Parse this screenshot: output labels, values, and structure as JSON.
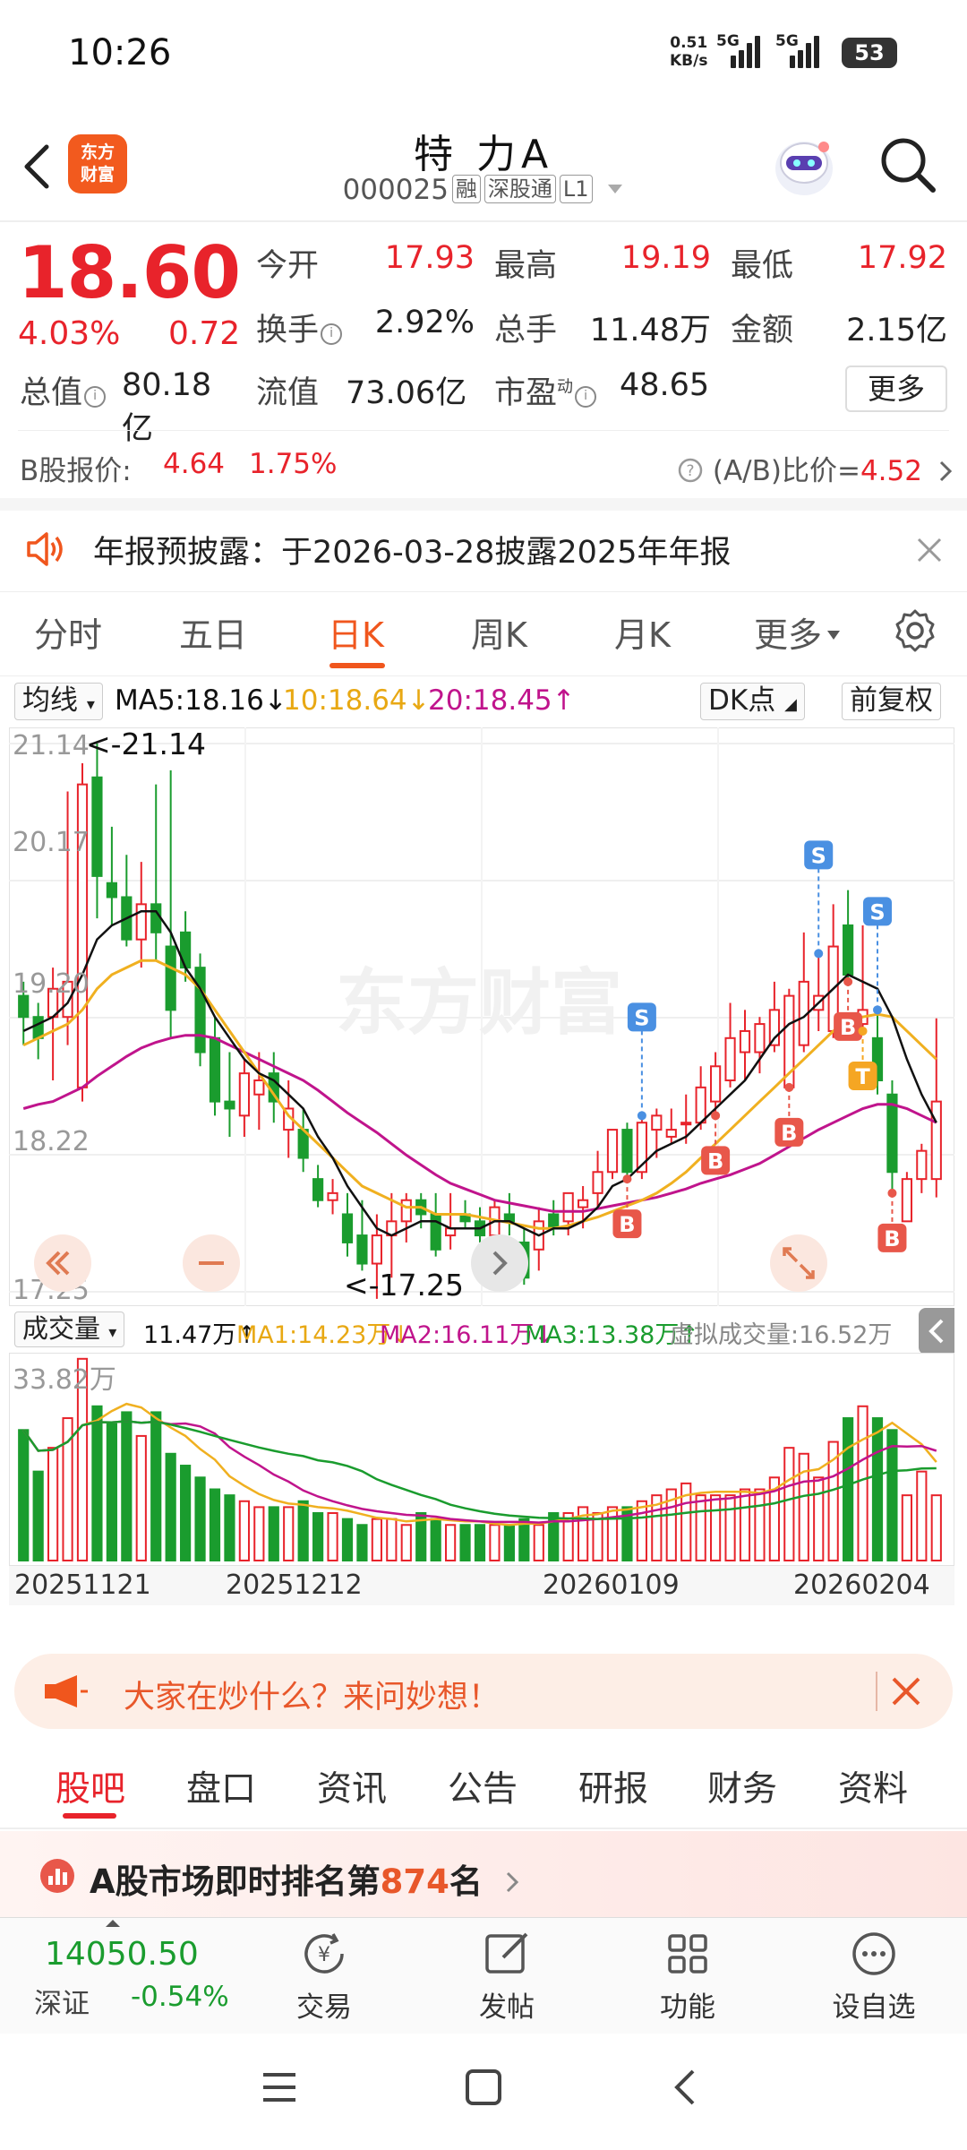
{
  "status_bar": {
    "time": "10:26",
    "net_speed_value": "0.51",
    "net_speed_unit": "KB/s",
    "sim1": "5G",
    "sim2": "5G",
    "battery": "53"
  },
  "header": {
    "brand_line1": "东方",
    "brand_line2": "财富",
    "stock_name": "特 力A",
    "stock_code": "000025",
    "tags": [
      "融",
      "深股通",
      "L1"
    ]
  },
  "quote": {
    "price": "18.60",
    "change_pct": "4.03%",
    "change": "0.72",
    "open_label": "今开",
    "open": "17.93",
    "high_label": "最高",
    "high": "19.19",
    "low_label": "最低",
    "low": "17.92",
    "turnover_label": "换手",
    "turnover": "2.92%",
    "volume_label": "总手",
    "volume": "11.48万",
    "amount_label": "金额",
    "amount": "2.15亿",
    "mcap_label": "总值",
    "mcap": "80.18亿",
    "float_label": "流值",
    "float_cap": "73.06亿",
    "pe_label": "市盈",
    "pe_sup": "动",
    "pe": "48.65",
    "more_label": "更多",
    "b_label": "B股报价:",
    "b_price": "4.64",
    "b_pct": "1.75%",
    "ab_label": "(A/B)比价=",
    "ab_value": "4.52"
  },
  "notice": {
    "text": "年报预披露：于2026-03-28披露2025年年报"
  },
  "period_tabs": [
    "分时",
    "五日",
    "日K",
    "周K",
    "月K",
    "更多"
  ],
  "ma_row": {
    "selector": "均线",
    "ma5": "MA5:18.16↓",
    "ma10": "10:18.64↓",
    "ma20": "20:18.45↑",
    "dk": "DK点",
    "adjust": "前复权"
  },
  "colors": {
    "up": "#e8232b",
    "down": "#1a9c2e",
    "ma5": "#111111",
    "ma10": "#f0b020",
    "ma20": "#c0148c",
    "accent": "#f0561d"
  },
  "kline_labels": {
    "y_ticks": [
      "21.14",
      "20.17",
      "19.20",
      "18.22",
      "17.25"
    ],
    "max_note": "<-21.14",
    "min_note": "<-17.25",
    "watermark": "东方财富"
  },
  "volume_head": {
    "selector": "成交量",
    "vol": "11.47万↑",
    "ma1": "MA1:14.23万↓",
    "ma2": "MA2:16.11万↓",
    "ma3": "MA3:13.38万↑",
    "virtual": "虚拟成交量:16.52万",
    "y_max": "33.82万"
  },
  "dates": [
    "20251121",
    "20251212",
    "20260109",
    "20260204"
  ],
  "chart_data": {
    "type": "candlestick",
    "ylim": [
      17.25,
      21.14
    ],
    "ohlc": [
      [
        19.35,
        19.45,
        19.0,
        19.2
      ],
      [
        19.2,
        19.3,
        18.9,
        19.05
      ],
      [
        19.2,
        19.55,
        18.75,
        19.4
      ],
      [
        19.2,
        20.8,
        19.0,
        19.45
      ],
      [
        18.7,
        21.0,
        18.6,
        20.85
      ],
      [
        20.9,
        21.14,
        19.9,
        20.2
      ],
      [
        20.15,
        20.55,
        19.85,
        20.05
      ],
      [
        20.05,
        20.35,
        19.7,
        19.75
      ],
      [
        19.75,
        20.3,
        19.55,
        20.0
      ],
      [
        20.0,
        20.85,
        19.6,
        19.8
      ],
      [
        19.7,
        20.95,
        19.05,
        19.25
      ],
      [
        19.8,
        19.95,
        19.45,
        19.55
      ],
      [
        19.55,
        19.65,
        18.85,
        18.95
      ],
      [
        19.05,
        19.2,
        18.5,
        18.6
      ],
      [
        18.6,
        18.95,
        18.35,
        18.55
      ],
      [
        18.5,
        18.9,
        18.35,
        18.8
      ],
      [
        18.65,
        18.95,
        18.4,
        18.75
      ],
      [
        18.8,
        18.95,
        18.45,
        18.6
      ],
      [
        18.4,
        18.75,
        18.2,
        18.55
      ],
      [
        18.4,
        18.55,
        18.1,
        18.2
      ],
      [
        18.05,
        18.15,
        17.85,
        17.9
      ],
      [
        17.9,
        18.05,
        17.8,
        17.95
      ],
      [
        17.8,
        17.95,
        17.5,
        17.6
      ],
      [
        17.65,
        17.9,
        17.4,
        17.45
      ],
      [
        17.45,
        17.8,
        17.2,
        17.65
      ],
      [
        17.65,
        17.95,
        17.35,
        17.75
      ],
      [
        17.75,
        17.95,
        17.6,
        17.9
      ],
      [
        17.9,
        17.95,
        17.7,
        17.8
      ],
      [
        17.8,
        17.95,
        17.5,
        17.55
      ],
      [
        17.65,
        17.95,
        17.55,
        17.7
      ],
      [
        17.8,
        17.9,
        17.7,
        17.75
      ],
      [
        17.75,
        17.85,
        17.6,
        17.65
      ],
      [
        17.65,
        17.9,
        17.55,
        17.85
      ],
      [
        17.8,
        17.95,
        17.65,
        17.75
      ],
      [
        17.6,
        17.7,
        17.3,
        17.35
      ],
      [
        17.55,
        17.85,
        17.4,
        17.75
      ],
      [
        17.8,
        17.9,
        17.65,
        17.7
      ],
      [
        17.75,
        17.95,
        17.65,
        17.95
      ],
      [
        17.85,
        18.0,
        17.7,
        17.9
      ],
      [
        17.95,
        18.25,
        17.85,
        18.1
      ],
      [
        18.1,
        18.4,
        18.05,
        18.4
      ],
      [
        18.4,
        18.45,
        18.05,
        18.1
      ],
      [
        18.1,
        18.5,
        18.05,
        18.45
      ],
      [
        18.4,
        18.55,
        18.2,
        18.5
      ],
      [
        18.35,
        18.55,
        18.3,
        18.4
      ],
      [
        18.45,
        18.65,
        18.3,
        18.45
      ],
      [
        18.45,
        18.85,
        18.4,
        18.7
      ],
      [
        18.6,
        18.95,
        18.5,
        18.85
      ],
      [
        18.75,
        19.3,
        18.7,
        19.05
      ],
      [
        18.95,
        19.25,
        18.75,
        19.1
      ],
      [
        18.95,
        19.2,
        18.8,
        19.15
      ],
      [
        19.0,
        19.45,
        18.95,
        19.25
      ],
      [
        18.7,
        19.4,
        18.7,
        19.35
      ],
      [
        19.0,
        19.8,
        18.95,
        19.45
      ],
      [
        19.25,
        19.65,
        19.1,
        19.35
      ],
      [
        19.1,
        20.0,
        19.05,
        19.7
      ],
      [
        19.85,
        20.1,
        19.45,
        19.5
      ],
      [
        19.15,
        19.85,
        19.1,
        19.25
      ],
      [
        19.05,
        19.25,
        18.65,
        18.75
      ],
      [
        18.65,
        18.75,
        17.95,
        18.1
      ],
      [
        17.75,
        18.1,
        17.75,
        18.05
      ],
      [
        18.05,
        18.3,
        17.95,
        18.25
      ],
      [
        18.05,
        19.19,
        17.92,
        18.6
      ]
    ],
    "ma5": [
      19.1,
      19.15,
      19.2,
      19.3,
      19.5,
      19.75,
      19.85,
      19.9,
      19.95,
      19.95,
      19.8,
      19.55,
      19.4,
      19.2,
      19.05,
      18.9,
      18.8,
      18.75,
      18.65,
      18.55,
      18.35,
      18.2,
      18.0,
      17.85,
      17.7,
      17.65,
      17.7,
      17.75,
      17.75,
      17.7,
      17.7,
      17.7,
      17.75,
      17.75,
      17.7,
      17.65,
      17.7,
      17.7,
      17.75,
      17.85,
      18.0,
      18.05,
      18.15,
      18.25,
      18.3,
      18.35,
      18.45,
      18.55,
      18.65,
      18.75,
      18.9,
      19.05,
      19.15,
      19.2,
      19.3,
      19.4,
      19.5,
      19.45,
      19.4,
      19.2,
      18.9,
      18.65,
      18.45
    ],
    "ma10": [
      19.0,
      19.05,
      19.1,
      19.15,
      19.25,
      19.4,
      19.5,
      19.55,
      19.6,
      19.6,
      19.55,
      19.5,
      19.4,
      19.25,
      19.1,
      18.95,
      18.8,
      18.65,
      18.5,
      18.4,
      18.3,
      18.2,
      18.1,
      18.0,
      17.95,
      17.9,
      17.85,
      17.85,
      17.8,
      17.8,
      17.8,
      17.78,
      17.76,
      17.74,
      17.72,
      17.7,
      17.7,
      17.72,
      17.75,
      17.78,
      17.82,
      17.86,
      17.9,
      17.95,
      18.02,
      18.1,
      18.2,
      18.3,
      18.4,
      18.5,
      18.6,
      18.7,
      18.8,
      18.9,
      19.0,
      19.1,
      19.15,
      19.2,
      19.22,
      19.2,
      19.1,
      19.0,
      18.9
    ],
    "ma20": [
      18.55,
      18.58,
      18.6,
      18.65,
      18.7,
      18.78,
      18.85,
      18.92,
      18.98,
      19.02,
      19.05,
      19.07,
      19.07,
      19.05,
      19.0,
      18.95,
      18.9,
      18.85,
      18.8,
      18.75,
      18.68,
      18.6,
      18.52,
      18.45,
      18.38,
      18.3,
      18.22,
      18.15,
      18.08,
      18.02,
      17.98,
      17.94,
      17.9,
      17.88,
      17.86,
      17.84,
      17.82,
      17.82,
      17.82,
      17.84,
      17.86,
      17.88,
      17.9,
      17.92,
      17.95,
      17.98,
      18.02,
      18.05,
      18.08,
      18.12,
      18.16,
      18.22,
      18.28,
      18.34,
      18.4,
      18.45,
      18.5,
      18.55,
      18.58,
      18.58,
      18.55,
      18.5,
      18.45
    ],
    "volume_max": 33.82,
    "volume": [
      22,
      15,
      19,
      24,
      34,
      26,
      23,
      25,
      21,
      25,
      18,
      16,
      14,
      12,
      11,
      10,
      9,
      9,
      9,
      10,
      8,
      8,
      7,
      6,
      7,
      7,
      6,
      8,
      7,
      6,
      6,
      6,
      6,
      6,
      7,
      6,
      8,
      8,
      9,
      8,
      9,
      9,
      10,
      11,
      12,
      13,
      11,
      11,
      11,
      12,
      12,
      14,
      19,
      18,
      14,
      20,
      24,
      26,
      24,
      22,
      11,
      15,
      11
    ],
    "markers": [
      {
        "index": 41,
        "label": "B"
      },
      {
        "index": 47,
        "label": "B"
      },
      {
        "index": 52,
        "label": "B"
      },
      {
        "index": 56,
        "label": "B"
      },
      {
        "index": 59,
        "label": "B"
      },
      {
        "index": 57,
        "label": "T"
      },
      {
        "index": 42,
        "label": "S"
      },
      {
        "index": 54,
        "label": "S"
      },
      {
        "index": 58,
        "label": "S"
      },
      {
        "index": 63,
        "label": "S"
      }
    ]
  },
  "ask_banner": {
    "text": "大家在炒什么？来问妙想！"
  },
  "content_tabs": [
    "股吧",
    "盘口",
    "资讯",
    "公告",
    "研报",
    "财务",
    "资料"
  ],
  "rank": {
    "prefix": "A股市场即时排名第",
    "number": "874",
    "suffix": "名"
  },
  "index_bar": {
    "value": "14050.50",
    "name": "深证",
    "change": "-0.54%"
  },
  "toolbar": {
    "trade": "交易",
    "post": "发帖",
    "functions": "功能",
    "watchlist": "设自选"
  }
}
